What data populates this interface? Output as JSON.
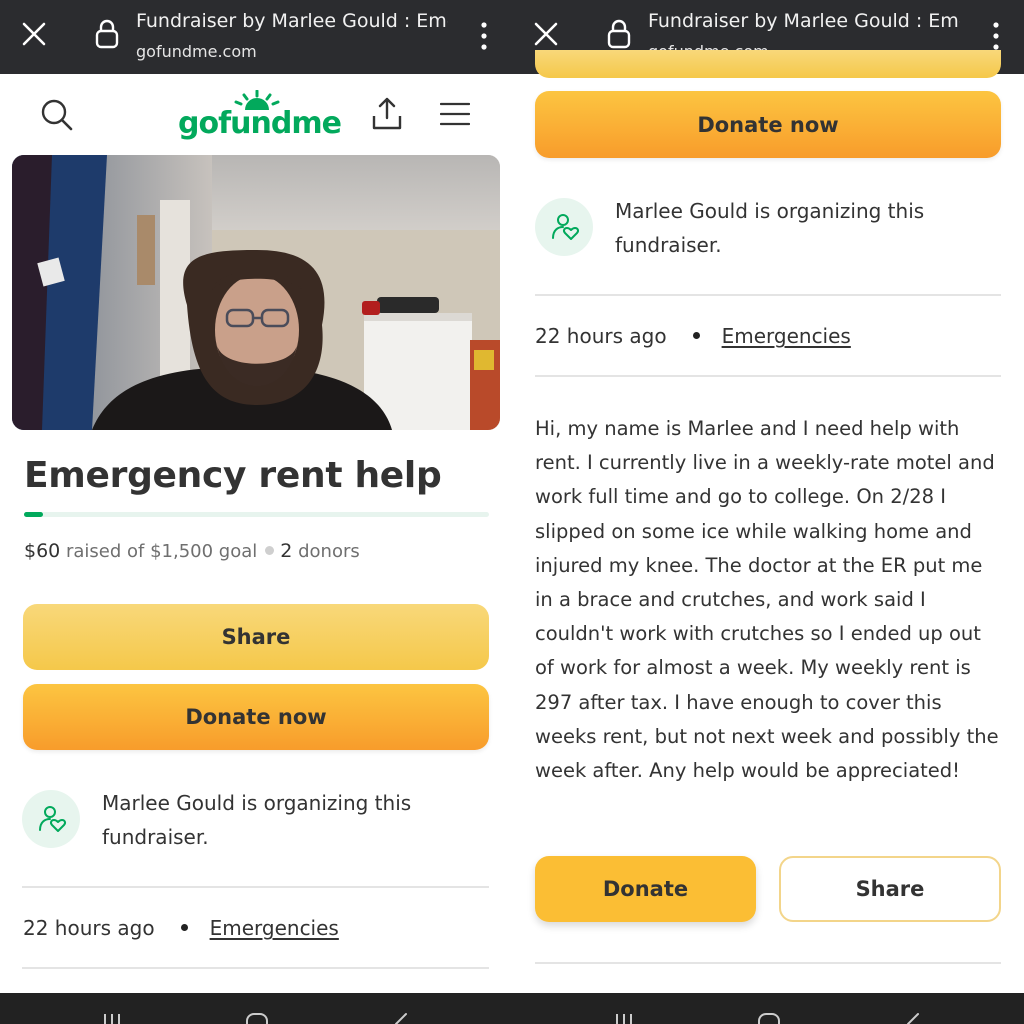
{
  "browser": {
    "title": "Fundraiser by Marlee Gould : Emergency rent help",
    "url": "gofundme.com"
  },
  "site": {
    "logo_text": "gofundme"
  },
  "campaign": {
    "title": "Emergency rent help",
    "progress_fraction": 0.04,
    "raised_amount": "$60",
    "raised_text": "raised of $1,500 goal",
    "donors_count": "2",
    "donors_label": "donors",
    "share_label": "Share",
    "donate_label": "Donate now",
    "organizer_text": "Marlee Gould is organizing this fundraiser.",
    "time_ago": "22 hours ago",
    "category": "Emergencies",
    "story": "Hi, my name is Marlee and I need help with rent. I currently live in a weekly-rate motel and work full time and go to college. On 2/28 I slipped on some ice while walking home and injured my knee. The doctor at the ER put me in a brace and crutches, and work said I couldn't work with crutches so I ended up out of work for almost a week. My weekly rent is 297 after tax. I have enough to cover this weeks rent, but not next week and possibly the week after. Any help would be appreciated!",
    "donate_short_label": "Donate",
    "share_outline_label": "Share"
  },
  "colors": {
    "brand_green": "#02a95c",
    "donate_orange": "#f89c2b",
    "share_yellow": "#f5c84a",
    "topbar": "#2b2c2f"
  },
  "icons": [
    "close-icon",
    "lock-icon",
    "more-vert-icon",
    "search-icon",
    "share-upload-icon",
    "hamburger-menu-icon",
    "organizer-heart-icon"
  ]
}
